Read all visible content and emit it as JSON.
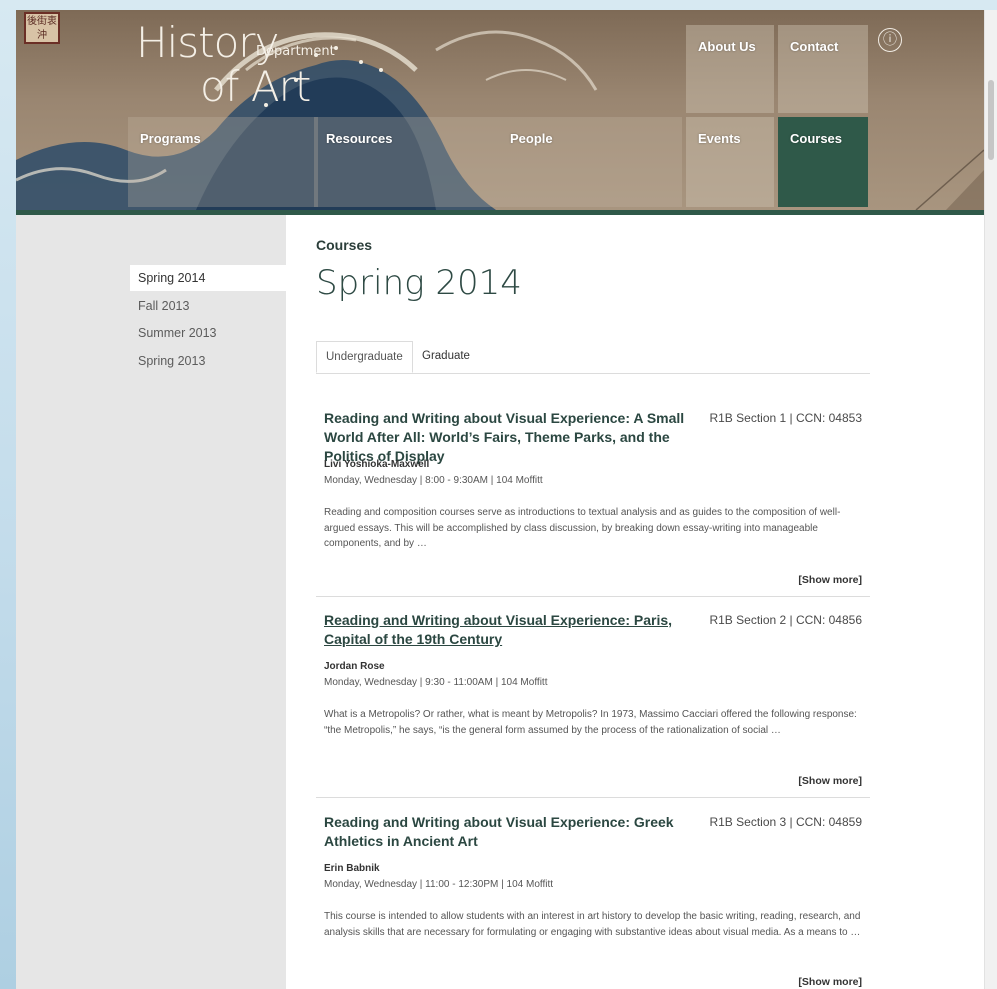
{
  "header": {
    "seal_text": "後街衷沖",
    "title_line1": "History",
    "title_dept": "Department",
    "title_line2": "of Art",
    "nav": {
      "about": "About Us",
      "contact": "Contact",
      "programs": "Programs",
      "resources": "Resources",
      "people": "People",
      "events": "Events",
      "courses": "Courses"
    },
    "info_icon": "ⓘ"
  },
  "sidebar": {
    "terms": [
      "Spring 2014",
      "Fall 2013",
      "Summer 2013",
      "Spring 2013"
    ],
    "active_index": 0
  },
  "main": {
    "breadcrumb": "Courses",
    "title": "Spring 2014",
    "tabs": [
      "Undergraduate",
      "Graduate"
    ],
    "active_tab": 0,
    "show_more_label": "[Show more]",
    "courses": [
      {
        "title": "Reading and Writing about Visual Experience: A Small World After All: World’s Fairs, Theme Parks, and the Politics of Display",
        "section": "R1B Section 1 | CCN: 04853",
        "instructor": "Livi Yoshioka-Maxwell",
        "schedule": "Monday, Wednesday | 8:00 - 9:30AM | 104 Moffitt",
        "description": "Reading and composition courses serve as introductions to textual analysis and as guides to the composition of well-argued essays. This will be accomplished by class discussion, by breaking down essay-writing into manageable components, and by …"
      },
      {
        "title": "Reading and Writing about Visual Experience: Paris, Capital of the 19th Century",
        "section": "R1B Section 2 | CCN: 04856",
        "instructor": "Jordan Rose",
        "schedule": "Monday, Wednesday | 9:30 - 11:00AM | 104 Moffitt",
        "description": "What is a Metropolis? Or rather, what is meant by Metropolis? In 1973, Massimo Cacciari offered the following response: “the Metropolis,” he says, “is the general form assumed by the process of the rationalization of social …"
      },
      {
        "title": "Reading and Writing about Visual Experience: Greek Athletics in Ancient Art",
        "section": "R1B Section 3 | CCN: 04859",
        "instructor": "Erin Babnik",
        "schedule": "Monday, Wednesday | 11:00 - 12:30PM | 104 Moffitt",
        "description": "This course is intended to allow students with an interest in art history to develop the basic writing, reading, research, and analysis skills that are necessary for formulating or engaging with substantive ideas about visual media. As a means to …"
      }
    ]
  },
  "colors": {
    "accent_green": "#2f5949",
    "title_green": "#2e4a44",
    "sidebar_bg": "#e6e6e6"
  }
}
